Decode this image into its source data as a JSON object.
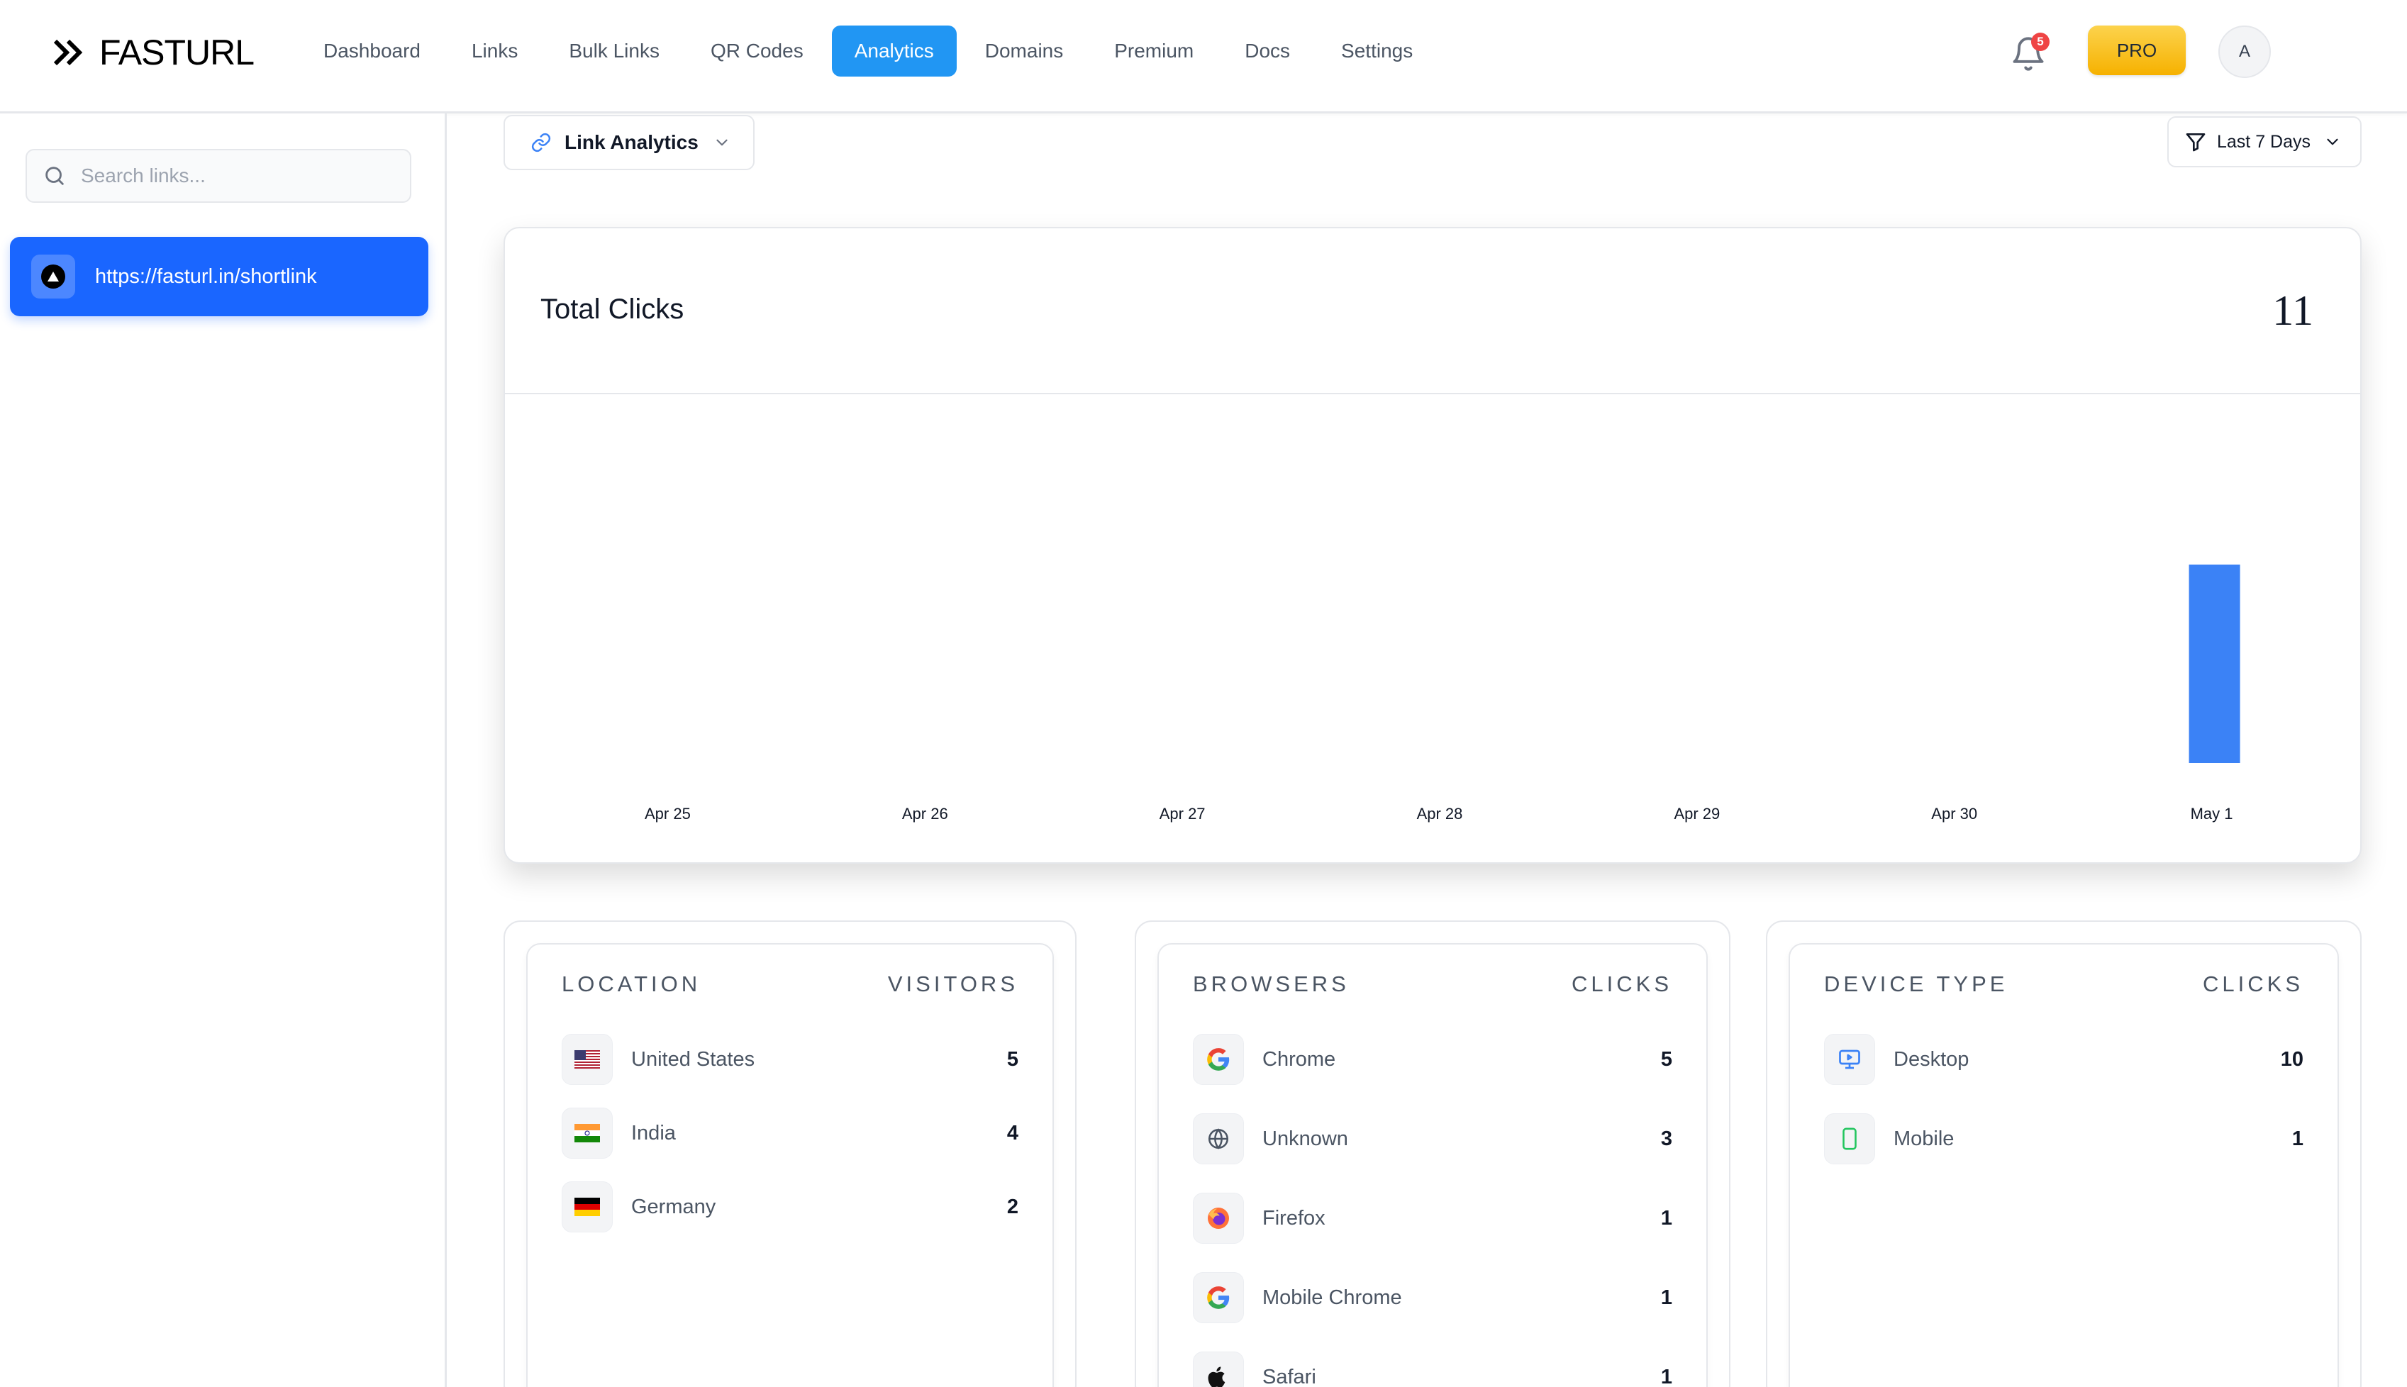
{
  "brand": {
    "name": "FASTURL"
  },
  "nav": [
    {
      "label": "Dashboard",
      "active": false
    },
    {
      "label": "Links",
      "active": false
    },
    {
      "label": "Bulk Links",
      "active": false
    },
    {
      "label": "QR Codes",
      "active": false
    },
    {
      "label": "Analytics",
      "active": true
    },
    {
      "label": "Domains",
      "active": false
    },
    {
      "label": "Premium",
      "active": false
    },
    {
      "label": "Docs",
      "active": false
    },
    {
      "label": "Settings",
      "active": false
    }
  ],
  "header": {
    "notifications": "5",
    "pro_label": "PRO",
    "avatar_initial": "A"
  },
  "sidebar": {
    "search_placeholder": "Search links...",
    "links": [
      {
        "label": "https://fasturl.in/shortlink",
        "selected": true
      }
    ]
  },
  "toolbar": {
    "analytics_label": "Link Analytics",
    "range_label": "Last 7 Days"
  },
  "chart": {
    "title": "Total Clicks",
    "total": "11"
  },
  "chart_data": {
    "type": "bar",
    "title": "Total Clicks",
    "categories": [
      "Apr 25",
      "Apr 26",
      "Apr 27",
      "Apr 28",
      "Apr 29",
      "Apr 30",
      "May 1"
    ],
    "values": [
      0,
      0,
      0,
      0,
      0,
      0,
      11
    ],
    "xlabel": "",
    "ylabel": "",
    "ylim": [
      0,
      11
    ],
    "grid": false,
    "color": "#3b82f6"
  },
  "location": {
    "title": "LOCATION",
    "col": "VISITORS",
    "rows": [
      {
        "name": "United States",
        "value": "5",
        "icon": "us-flag-icon"
      },
      {
        "name": "India",
        "value": "4",
        "icon": "india-flag-icon"
      },
      {
        "name": "Germany",
        "value": "2",
        "icon": "germany-flag-icon"
      }
    ]
  },
  "browsers": {
    "title": "BROWSERS",
    "col": "CLICKS",
    "rows": [
      {
        "name": "Chrome",
        "value": "5",
        "icon": "chrome-icon"
      },
      {
        "name": "Unknown",
        "value": "3",
        "icon": "globe-icon"
      },
      {
        "name": "Firefox",
        "value": "1",
        "icon": "firefox-icon"
      },
      {
        "name": "Mobile Chrome",
        "value": "1",
        "icon": "chrome-icon"
      },
      {
        "name": "Safari",
        "value": "1",
        "icon": "apple-icon"
      }
    ]
  },
  "devices": {
    "title": "DEVICE TYPE",
    "col": "CLICKS",
    "rows": [
      {
        "name": "Desktop",
        "value": "10",
        "icon": "desktop-icon"
      },
      {
        "name": "Mobile",
        "value": "1",
        "icon": "mobile-icon"
      }
    ]
  }
}
